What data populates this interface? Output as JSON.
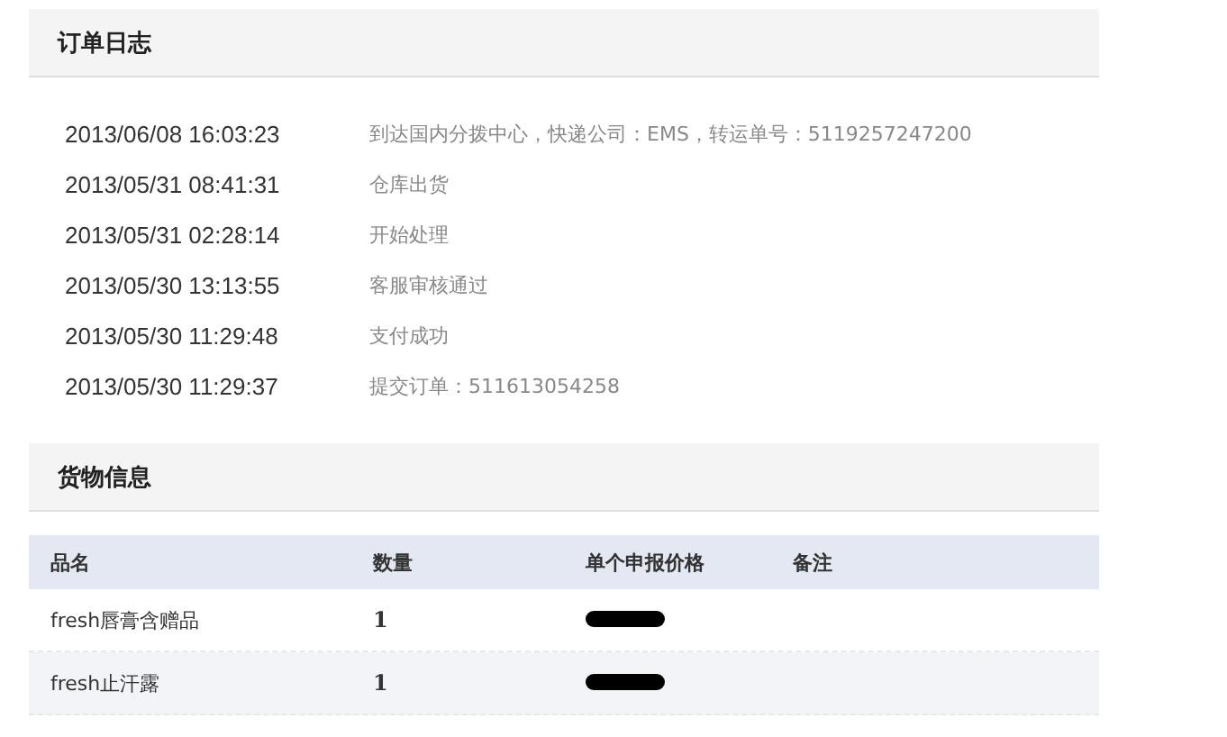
{
  "order_log": {
    "title": "订单日志",
    "entries": [
      {
        "time": "2013/06/08 16:03:23",
        "event": "到达国内分拨中心，快递公司：EMS，转运单号：5119257247200"
      },
      {
        "time": "2013/05/31 08:41:31",
        "event": "仓库出货"
      },
      {
        "time": "2013/05/31 02:28:14",
        "event": "开始处理"
      },
      {
        "time": "2013/05/30 13:13:55",
        "event": "客服审核通过"
      },
      {
        "time": "2013/05/30 11:29:48",
        "event": "支付成功"
      },
      {
        "time": "2013/05/30 11:29:37",
        "event": "提交订单：511613054258"
      }
    ]
  },
  "goods": {
    "title": "货物信息",
    "columns": [
      "品名",
      "数量",
      "单个申报价格",
      "备注"
    ],
    "rows": [
      {
        "name": "fresh唇膏含赠品",
        "quantity": "1",
        "price_redacted": true
      },
      {
        "name": "fresh止汗露",
        "quantity": "1",
        "price_redacted": true
      }
    ]
  }
}
